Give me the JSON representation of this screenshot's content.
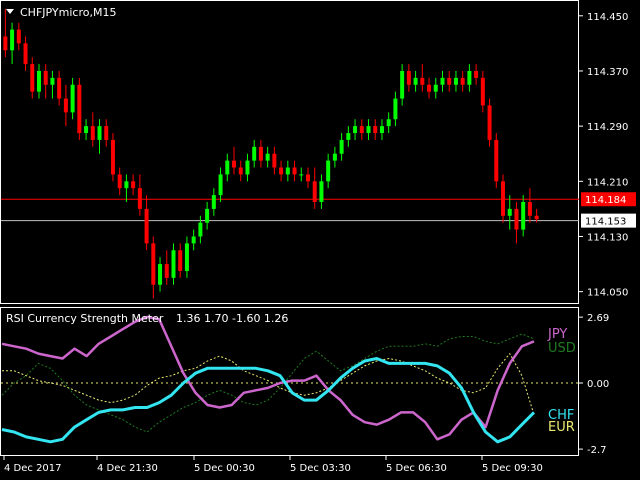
{
  "window": {
    "symbol_title": "CHFJPYmicro,M15"
  },
  "colors": {
    "background": "#000000",
    "grid": "#ffffff",
    "bull": "#00ff00",
    "bear": "#ff0000",
    "bid_line": "#ff0000",
    "ask_line": "#c0c0c0",
    "jpy": "#cc66cc",
    "usd": "#1f7a1f",
    "chf": "#33e5f0",
    "eur": "#e8e870",
    "zero_line": "#e8e870"
  },
  "price_axis": {
    "ticks": [
      "114.450",
      "114.370",
      "114.290",
      "114.210",
      "114.130",
      "114.050"
    ],
    "bid_label": "114.184",
    "ask_label": "114.153"
  },
  "indicator": {
    "name": "RSI Currency Strength Meter",
    "values_text": "1.36 1.70 -1.60 1.26",
    "ticks": [
      "2.69",
      "0.00",
      "-2.7"
    ],
    "legend": [
      {
        "name": "JPY",
        "color": "#cc66cc"
      },
      {
        "name": "USD",
        "color": "#1f7a1f"
      },
      {
        "name": "CHF",
        "color": "#33e5f0"
      },
      {
        "name": "EUR",
        "color": "#e8e870"
      }
    ]
  },
  "time_axis": {
    "labels": [
      "4 Dec 2017",
      "4 Dec 21:30",
      "5 Dec 00:30",
      "5 Dec 03:30",
      "5 Dec 06:30",
      "5 Dec 09:30"
    ]
  },
  "chart_data": {
    "type": "candlestick",
    "price_ylim": [
      114.035,
      114.47
    ],
    "bid": 114.184,
    "ask": 114.153,
    "candles": [
      [
        114.42,
        114.46,
        114.39,
        114.4
      ],
      [
        114.4,
        114.44,
        114.38,
        114.43
      ],
      [
        114.43,
        114.44,
        114.4,
        114.41
      ],
      [
        114.41,
        114.42,
        114.37,
        114.38
      ],
      [
        114.38,
        114.39,
        114.33,
        114.34
      ],
      [
        114.34,
        114.38,
        114.33,
        114.37
      ],
      [
        114.37,
        114.38,
        114.33,
        114.35
      ],
      [
        114.35,
        114.37,
        114.33,
        114.36
      ],
      [
        114.36,
        114.37,
        114.32,
        114.33
      ],
      [
        114.33,
        114.35,
        114.29,
        114.31
      ],
      [
        114.31,
        114.36,
        114.3,
        114.35
      ],
      [
        114.35,
        114.36,
        114.27,
        114.28
      ],
      [
        114.28,
        114.3,
        114.27,
        114.29
      ],
      [
        114.29,
        114.31,
        114.26,
        114.27
      ],
      [
        114.27,
        114.3,
        114.25,
        114.29
      ],
      [
        114.29,
        114.3,
        114.26,
        114.27
      ],
      [
        114.27,
        114.28,
        114.21,
        114.22
      ],
      [
        114.22,
        114.23,
        114.19,
        114.2
      ],
      [
        114.2,
        114.22,
        114.18,
        114.21
      ],
      [
        114.21,
        114.22,
        114.19,
        114.2
      ],
      [
        114.2,
        114.22,
        114.16,
        114.17
      ],
      [
        114.17,
        114.19,
        114.11,
        114.12
      ],
      [
        114.12,
        114.13,
        114.04,
        114.06
      ],
      [
        114.06,
        114.1,
        114.05,
        114.09
      ],
      [
        114.09,
        114.11,
        114.06,
        114.07
      ],
      [
        114.07,
        114.12,
        114.06,
        114.11
      ],
      [
        114.11,
        114.12,
        114.07,
        114.08
      ],
      [
        114.08,
        114.13,
        114.07,
        114.12
      ],
      [
        114.12,
        114.14,
        114.11,
        114.13
      ],
      [
        114.13,
        114.16,
        114.12,
        114.15
      ],
      [
        114.15,
        114.18,
        114.14,
        114.17
      ],
      [
        114.17,
        114.2,
        114.16,
        114.19
      ],
      [
        114.19,
        114.23,
        114.18,
        114.22
      ],
      [
        114.22,
        114.25,
        114.21,
        114.24
      ],
      [
        114.24,
        114.26,
        114.22,
        114.23
      ],
      [
        114.23,
        114.24,
        114.21,
        114.22
      ],
      [
        114.22,
        114.25,
        114.21,
        114.24
      ],
      [
        114.24,
        114.27,
        114.23,
        114.26
      ],
      [
        114.26,
        114.27,
        114.23,
        114.24
      ],
      [
        114.24,
        114.26,
        114.23,
        114.25
      ],
      [
        114.25,
        114.26,
        114.22,
        114.23
      ],
      [
        114.23,
        114.24,
        114.21,
        114.22
      ],
      [
        114.22,
        114.24,
        114.21,
        114.23
      ],
      [
        114.23,
        114.24,
        114.21,
        114.22
      ],
      [
        114.22,
        114.23,
        114.21,
        114.22
      ],
      [
        114.22,
        114.23,
        114.2,
        114.21
      ],
      [
        114.21,
        114.23,
        114.17,
        114.18
      ],
      [
        114.18,
        114.22,
        114.17,
        114.21
      ],
      [
        114.21,
        114.25,
        114.2,
        114.24
      ],
      [
        114.24,
        114.26,
        114.23,
        114.25
      ],
      [
        114.25,
        114.28,
        114.24,
        114.27
      ],
      [
        114.27,
        114.29,
        114.26,
        114.28
      ],
      [
        114.28,
        114.3,
        114.27,
        114.29
      ],
      [
        114.29,
        114.3,
        114.27,
        114.28
      ],
      [
        114.28,
        114.3,
        114.27,
        114.29
      ],
      [
        114.29,
        114.3,
        114.27,
        114.28
      ],
      [
        114.28,
        114.3,
        114.27,
        114.29
      ],
      [
        114.29,
        114.31,
        114.28,
        114.3
      ],
      [
        114.3,
        114.34,
        114.29,
        114.33
      ],
      [
        114.33,
        114.38,
        114.32,
        114.37
      ],
      [
        114.37,
        114.38,
        114.34,
        114.35
      ],
      [
        114.35,
        114.37,
        114.34,
        114.36
      ],
      [
        114.36,
        114.38,
        114.34,
        114.35
      ],
      [
        114.35,
        114.36,
        114.33,
        114.34
      ],
      [
        114.34,
        114.36,
        114.33,
        114.35
      ],
      [
        114.35,
        114.37,
        114.34,
        114.36
      ],
      [
        114.36,
        114.37,
        114.34,
        114.35
      ],
      [
        114.35,
        114.37,
        114.34,
        114.36
      ],
      [
        114.36,
        114.37,
        114.34,
        114.35
      ],
      [
        114.35,
        114.38,
        114.34,
        114.37
      ],
      [
        114.37,
        114.38,
        114.35,
        114.36
      ],
      [
        114.36,
        114.37,
        114.31,
        114.32
      ],
      [
        114.32,
        114.33,
        114.26,
        114.27
      ],
      [
        114.27,
        114.28,
        114.2,
        114.21
      ],
      [
        114.21,
        114.22,
        114.15,
        114.16
      ],
      [
        114.16,
        114.19,
        114.14,
        114.17
      ],
      [
        114.17,
        114.18,
        114.12,
        114.14
      ],
      [
        114.14,
        114.19,
        114.13,
        114.18
      ],
      [
        114.18,
        114.2,
        114.15,
        114.16
      ],
      [
        114.16,
        114.17,
        114.15,
        114.155
      ]
    ],
    "indicator_ylim": [
      -2.9,
      2.9
    ],
    "series": [
      {
        "name": "JPY",
        "values": [
          1.6,
          1.5,
          1.4,
          1.2,
          1.1,
          1.0,
          1.4,
          1.1,
          1.6,
          1.9,
          2.2,
          2.5,
          2.7,
          2.6,
          1.5,
          0.4,
          -0.4,
          -0.9,
          -1.0,
          -0.9,
          -0.4,
          -0.3,
          -0.2,
          0.0,
          0.1,
          0.1,
          0.3,
          -0.3,
          -0.7,
          -1.3,
          -1.6,
          -1.7,
          -1.5,
          -1.2,
          -1.2,
          -1.6,
          -2.3,
          -2.1,
          -1.5,
          -1.2,
          -1.8,
          -0.3,
          0.8,
          1.5,
          1.7
        ]
      },
      {
        "name": "USD",
        "values": [
          -0.5,
          0.0,
          0.3,
          0.8,
          0.6,
          0.1,
          -0.5,
          -0.9,
          -1.1,
          -1.3,
          -1.5,
          -1.8,
          -2.0,
          -1.6,
          -1.3,
          -1.0,
          -0.8,
          -0.5,
          -0.3,
          -0.5,
          -0.8,
          -0.9,
          -0.7,
          -0.2,
          0.4,
          1.0,
          1.3,
          0.9,
          0.5,
          0.7,
          1.0,
          1.3,
          1.5,
          1.5,
          1.5,
          1.6,
          1.5,
          1.8,
          1.9,
          1.9,
          1.7,
          1.6,
          1.8,
          2.0,
          1.8
        ]
      },
      {
        "name": "CHF",
        "values": [
          -1.9,
          -2.0,
          -2.2,
          -2.3,
          -2.4,
          -2.3,
          -1.8,
          -1.5,
          -1.2,
          -1.1,
          -1.1,
          -1.0,
          -1.0,
          -0.8,
          -0.5,
          0.0,
          0.4,
          0.6,
          0.6,
          0.6,
          0.6,
          0.6,
          0.5,
          0.3,
          -0.4,
          -0.7,
          -0.7,
          -0.3,
          0.2,
          0.6,
          0.9,
          1.0,
          0.8,
          0.8,
          0.8,
          0.8,
          0.7,
          0.4,
          -0.2,
          -1.2,
          -2.0,
          -2.4,
          -2.2,
          -1.7,
          -1.2
        ]
      },
      {
        "name": "EUR",
        "values": [
          0.5,
          0.5,
          0.3,
          0.1,
          0.0,
          -0.1,
          -0.3,
          -0.5,
          -0.7,
          -0.8,
          -0.7,
          -0.5,
          -0.1,
          0.2,
          0.3,
          0.5,
          0.6,
          0.9,
          1.1,
          0.9,
          0.5,
          0.3,
          0.1,
          -0.2,
          -0.4,
          -0.5,
          -0.4,
          -0.2,
          0.1,
          0.4,
          0.7,
          0.9,
          1.0,
          0.9,
          0.7,
          0.5,
          0.2,
          0.0,
          -0.3,
          -0.4,
          -0.2,
          0.6,
          1.2,
          0.3,
          -1.3
        ]
      }
    ]
  }
}
